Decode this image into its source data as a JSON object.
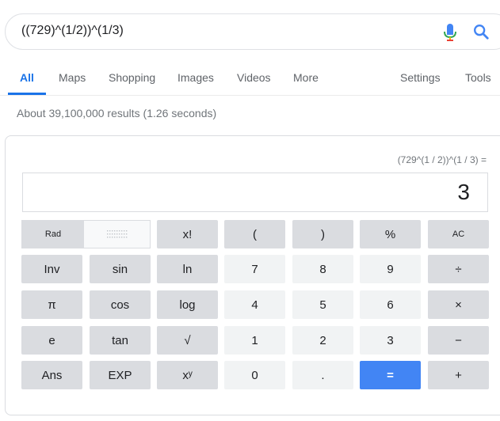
{
  "search": {
    "query": "((729)^(1/2))^(1/3)"
  },
  "tabs": [
    "All",
    "Maps",
    "Shopping",
    "Images",
    "Videos",
    "More",
    "Settings",
    "Tools"
  ],
  "stats": "About 39,100,000 results (1.26 seconds)",
  "calculator": {
    "expression": "(729^(1 / 2))^(1 / 3) =",
    "display": "3",
    "rows": [
      [
        {
          "label": "Rad",
          "type": "rad"
        },
        {
          "label": "",
          "type": "deg"
        },
        {
          "label": "x!",
          "type": "fn"
        },
        {
          "label": "(",
          "type": "fn"
        },
        {
          "label": ")",
          "type": "fn"
        },
        {
          "label": "%",
          "type": "fn"
        },
        {
          "label": "AC",
          "type": "fn"
        }
      ],
      [
        {
          "label": "Inv",
          "type": "fn"
        },
        {
          "label": "sin",
          "type": "fn"
        },
        {
          "label": "ln",
          "type": "fn"
        },
        {
          "label": "7",
          "type": "num"
        },
        {
          "label": "8",
          "type": "num"
        },
        {
          "label": "9",
          "type": "num"
        },
        {
          "label": "÷",
          "type": "op"
        }
      ],
      [
        {
          "label": "π",
          "type": "fn"
        },
        {
          "label": "cos",
          "type": "fn"
        },
        {
          "label": "log",
          "type": "fn"
        },
        {
          "label": "4",
          "type": "num"
        },
        {
          "label": "5",
          "type": "num"
        },
        {
          "label": "6",
          "type": "num"
        },
        {
          "label": "×",
          "type": "op"
        }
      ],
      [
        {
          "label": "e",
          "type": "fn"
        },
        {
          "label": "tan",
          "type": "fn"
        },
        {
          "label": "√",
          "type": "fn"
        },
        {
          "label": "1",
          "type": "num"
        },
        {
          "label": "2",
          "type": "num"
        },
        {
          "label": "3",
          "type": "num"
        },
        {
          "label": "−",
          "type": "op"
        }
      ],
      [
        {
          "label": "Ans",
          "type": "fn"
        },
        {
          "label": "EXP",
          "type": "fn"
        },
        {
          "label": "xʸ",
          "type": "fn"
        },
        {
          "label": "0",
          "type": "num"
        },
        {
          "label": ".",
          "type": "num"
        },
        {
          "label": "=",
          "type": "eq"
        },
        {
          "label": "+",
          "type": "op"
        }
      ]
    ]
  },
  "colors": {
    "accent": "#1a73e8",
    "equals": "#4285f4",
    "fn_key": "#dadce0",
    "num_key": "#f1f3f4"
  }
}
